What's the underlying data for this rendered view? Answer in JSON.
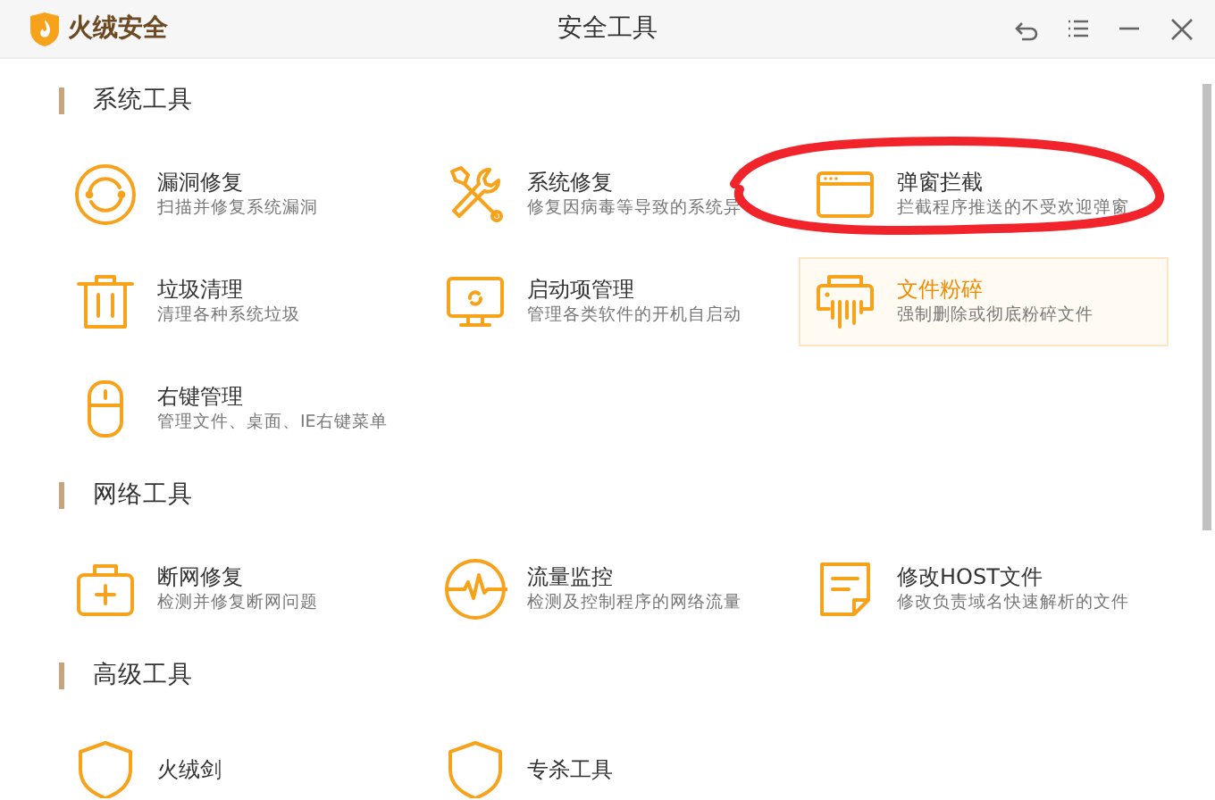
{
  "window": {
    "app_name": "火绒安全",
    "title": "安全工具"
  },
  "title_buttons": [
    {
      "kind": "back"
    },
    {
      "kind": "menu"
    },
    {
      "kind": "minimize"
    },
    {
      "kind": "close"
    }
  ],
  "sections": [
    {
      "title": "系统工具",
      "items": [
        {
          "name": "漏洞修复",
          "description": "扫描并修复系统漏洞",
          "hovered": false
        },
        {
          "name": "系统修复",
          "description": "修复因病毒等导致的系统异",
          "hovered": false
        },
        {
          "name": "弹窗拦截",
          "description": "拦截程序推送的不受欢迎弹窗",
          "hovered": false
        },
        {
          "name": "垃圾清理",
          "description": "清理各种系统垃圾",
          "hovered": false
        },
        {
          "name": "启动项管理",
          "description": "管理各类软件的开机自启动",
          "hovered": false
        },
        {
          "name": "文件粉碎",
          "description": "强制删除或彻底粉碎文件",
          "hovered": true
        },
        {
          "name": "右键管理",
          "description": "管理文件、桌面、IE右键菜单",
          "hovered": false
        }
      ]
    },
    {
      "title": "网络工具",
      "items": [
        {
          "name": "断网修复",
          "description": "检测并修复断网问题",
          "hovered": false
        },
        {
          "name": "流量监控",
          "description": "检测及控制程序的网络流量",
          "hovered": false
        },
        {
          "name": "修改HOST文件",
          "description": "修改负责域名快速解析的文件",
          "hovered": false
        }
      ]
    },
    {
      "title": "高级工具",
      "items": [
        {
          "name": "火绒剑",
          "hovered": false
        },
        {
          "name": "专杀工具",
          "hovered": false
        }
      ]
    }
  ],
  "annotation": {
    "kind": "ellipse"
  }
}
